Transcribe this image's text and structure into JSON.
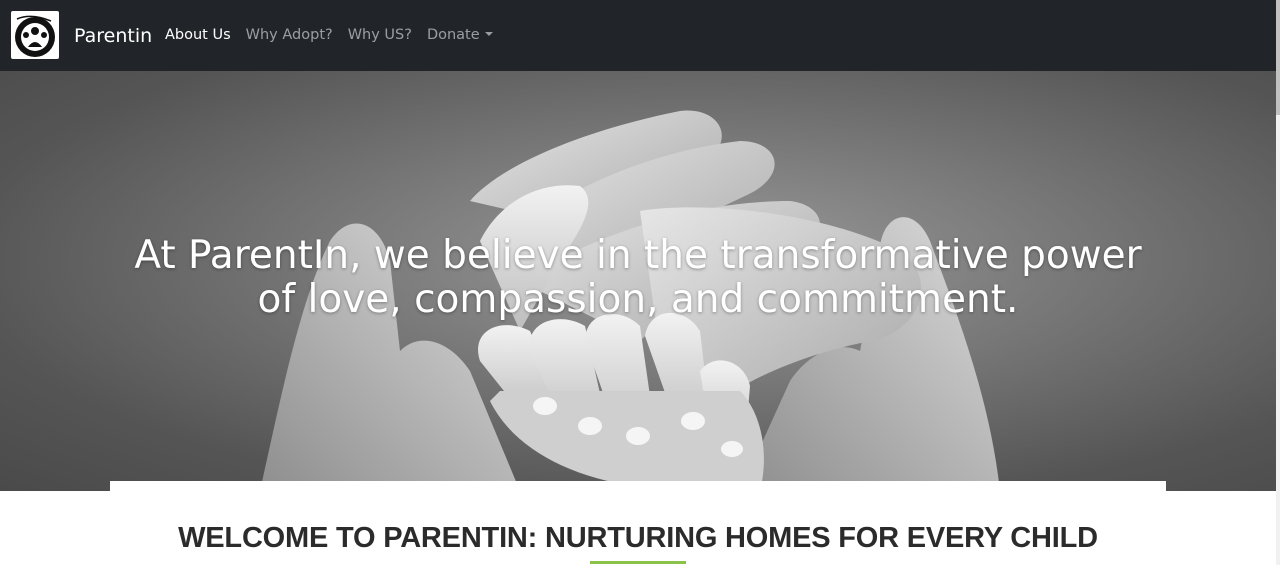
{
  "navbar": {
    "brand": "Parentin",
    "links": [
      {
        "label": "About Us",
        "active": true
      },
      {
        "label": "Why Adopt?",
        "active": false
      },
      {
        "label": "Why US?",
        "active": false
      },
      {
        "label": "Donate",
        "active": false,
        "dropdown": true
      }
    ],
    "background": "#212529"
  },
  "hero": {
    "heading_line1": "At ParentIn, we believe in the transformative power",
    "heading_line2": "of love, compassion, and commitment.",
    "image_description": "hands-holding-baby-hand-photo"
  },
  "section": {
    "title": "WELCOME TO PARENTIN: NURTURING HOMES FOR EVERY CHILD",
    "accent_color": "#8bc34a"
  }
}
